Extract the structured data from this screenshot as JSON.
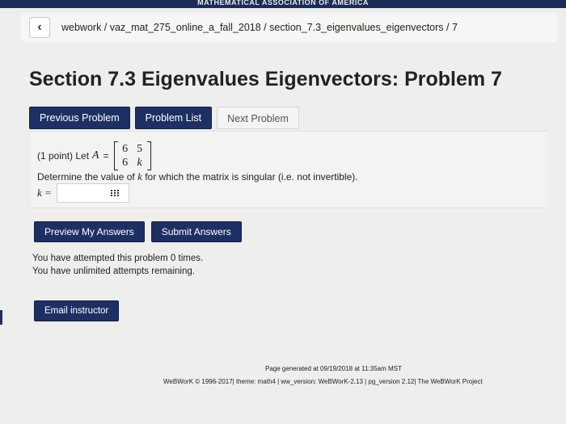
{
  "banner": {
    "text": "MATHEMATICAL ASSOCIATION OF AMERICA"
  },
  "breadcrumb": {
    "back_icon": "chevron-left-icon",
    "text": "webwork / vaz_mat_275_online_a_fall_2018 / section_7.3_eigenvalues_eigenvectors / 7"
  },
  "page_title": "Section 7.3 Eigenvalues Eigenvectors: Problem 7",
  "nav": {
    "previous": "Previous Problem",
    "list": "Problem List",
    "next": "Next Problem"
  },
  "problem": {
    "points": "(1 point) Let",
    "var_a": "A",
    "equals": "=",
    "matrix": {
      "r1c1": "6",
      "r1c2": "5",
      "r2c1": "6",
      "r2c2": "k"
    },
    "question_prefix": "Determine the value of",
    "question_var": "k",
    "question_suffix": "for which the matrix is singular (i.e. not invertible).",
    "answer_label": "k =",
    "answer_value": "",
    "answer_icon": "grid-icon"
  },
  "actions": {
    "preview": "Preview My Answers",
    "submit": "Submit Answers"
  },
  "attempts": {
    "line1": "You have attempted this problem 0 times.",
    "line2": "You have unlimited attempts remaining."
  },
  "email": "Email instructor",
  "footer": {
    "generated": "Page generated at 09/19/2018 at 11:35am MST",
    "credits": "WeBWorK © 1996-2017| theme: math4 | ww_version: WeBWorK-2.13 | pg_version 2.12| The WeBWorK Project"
  }
}
